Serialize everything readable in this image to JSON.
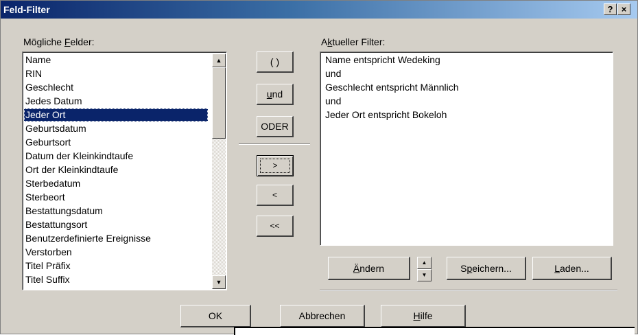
{
  "window": {
    "title": "Feld-Filter",
    "help_button": "?",
    "close_button": "×"
  },
  "fields": {
    "label_pre": "Mögliche ",
    "label_key": "F",
    "label_post": "elder:",
    "items": [
      "Name",
      "RIN",
      "Geschlecht",
      "Jedes Datum",
      "Jeder Ort",
      "Geburtsdatum",
      "Geburtsort",
      "Datum der Kleinkindtaufe",
      "Ort der Kleinkindtaufe",
      "Sterbedatum",
      "Sterbeort",
      "Bestattungsdatum",
      "Bestattungsort",
      "Benutzerdefinierte Ereignisse",
      "Verstorben",
      "Titel Präfix",
      "Titel Suffix"
    ],
    "selected": "Jeder Ort"
  },
  "operators": {
    "parens": "( )",
    "and_key": "u",
    "and_rest": "nd",
    "or": "ODER",
    "add": ">",
    "remove": "<",
    "remove_all": "<<"
  },
  "filter": {
    "label_pre": "A",
    "label_key": "k",
    "label_post": "tueller Filter:",
    "lines": [
      "Name entspricht Wedeking",
      "und",
      "Geschlecht entspricht Männlich",
      "und",
      "Jeder Ort entspricht Bokeloh"
    ]
  },
  "filter_buttons": {
    "change_key": "Ä",
    "change_rest": "ndern",
    "save_pre": "S",
    "save_key": "p",
    "save_post": "eichern...",
    "load_key": "L",
    "load_rest": "aden..."
  },
  "footer": {
    "ok": "OK",
    "cancel": "Abbrechen",
    "help_key": "H",
    "help_rest": "ilfe"
  }
}
